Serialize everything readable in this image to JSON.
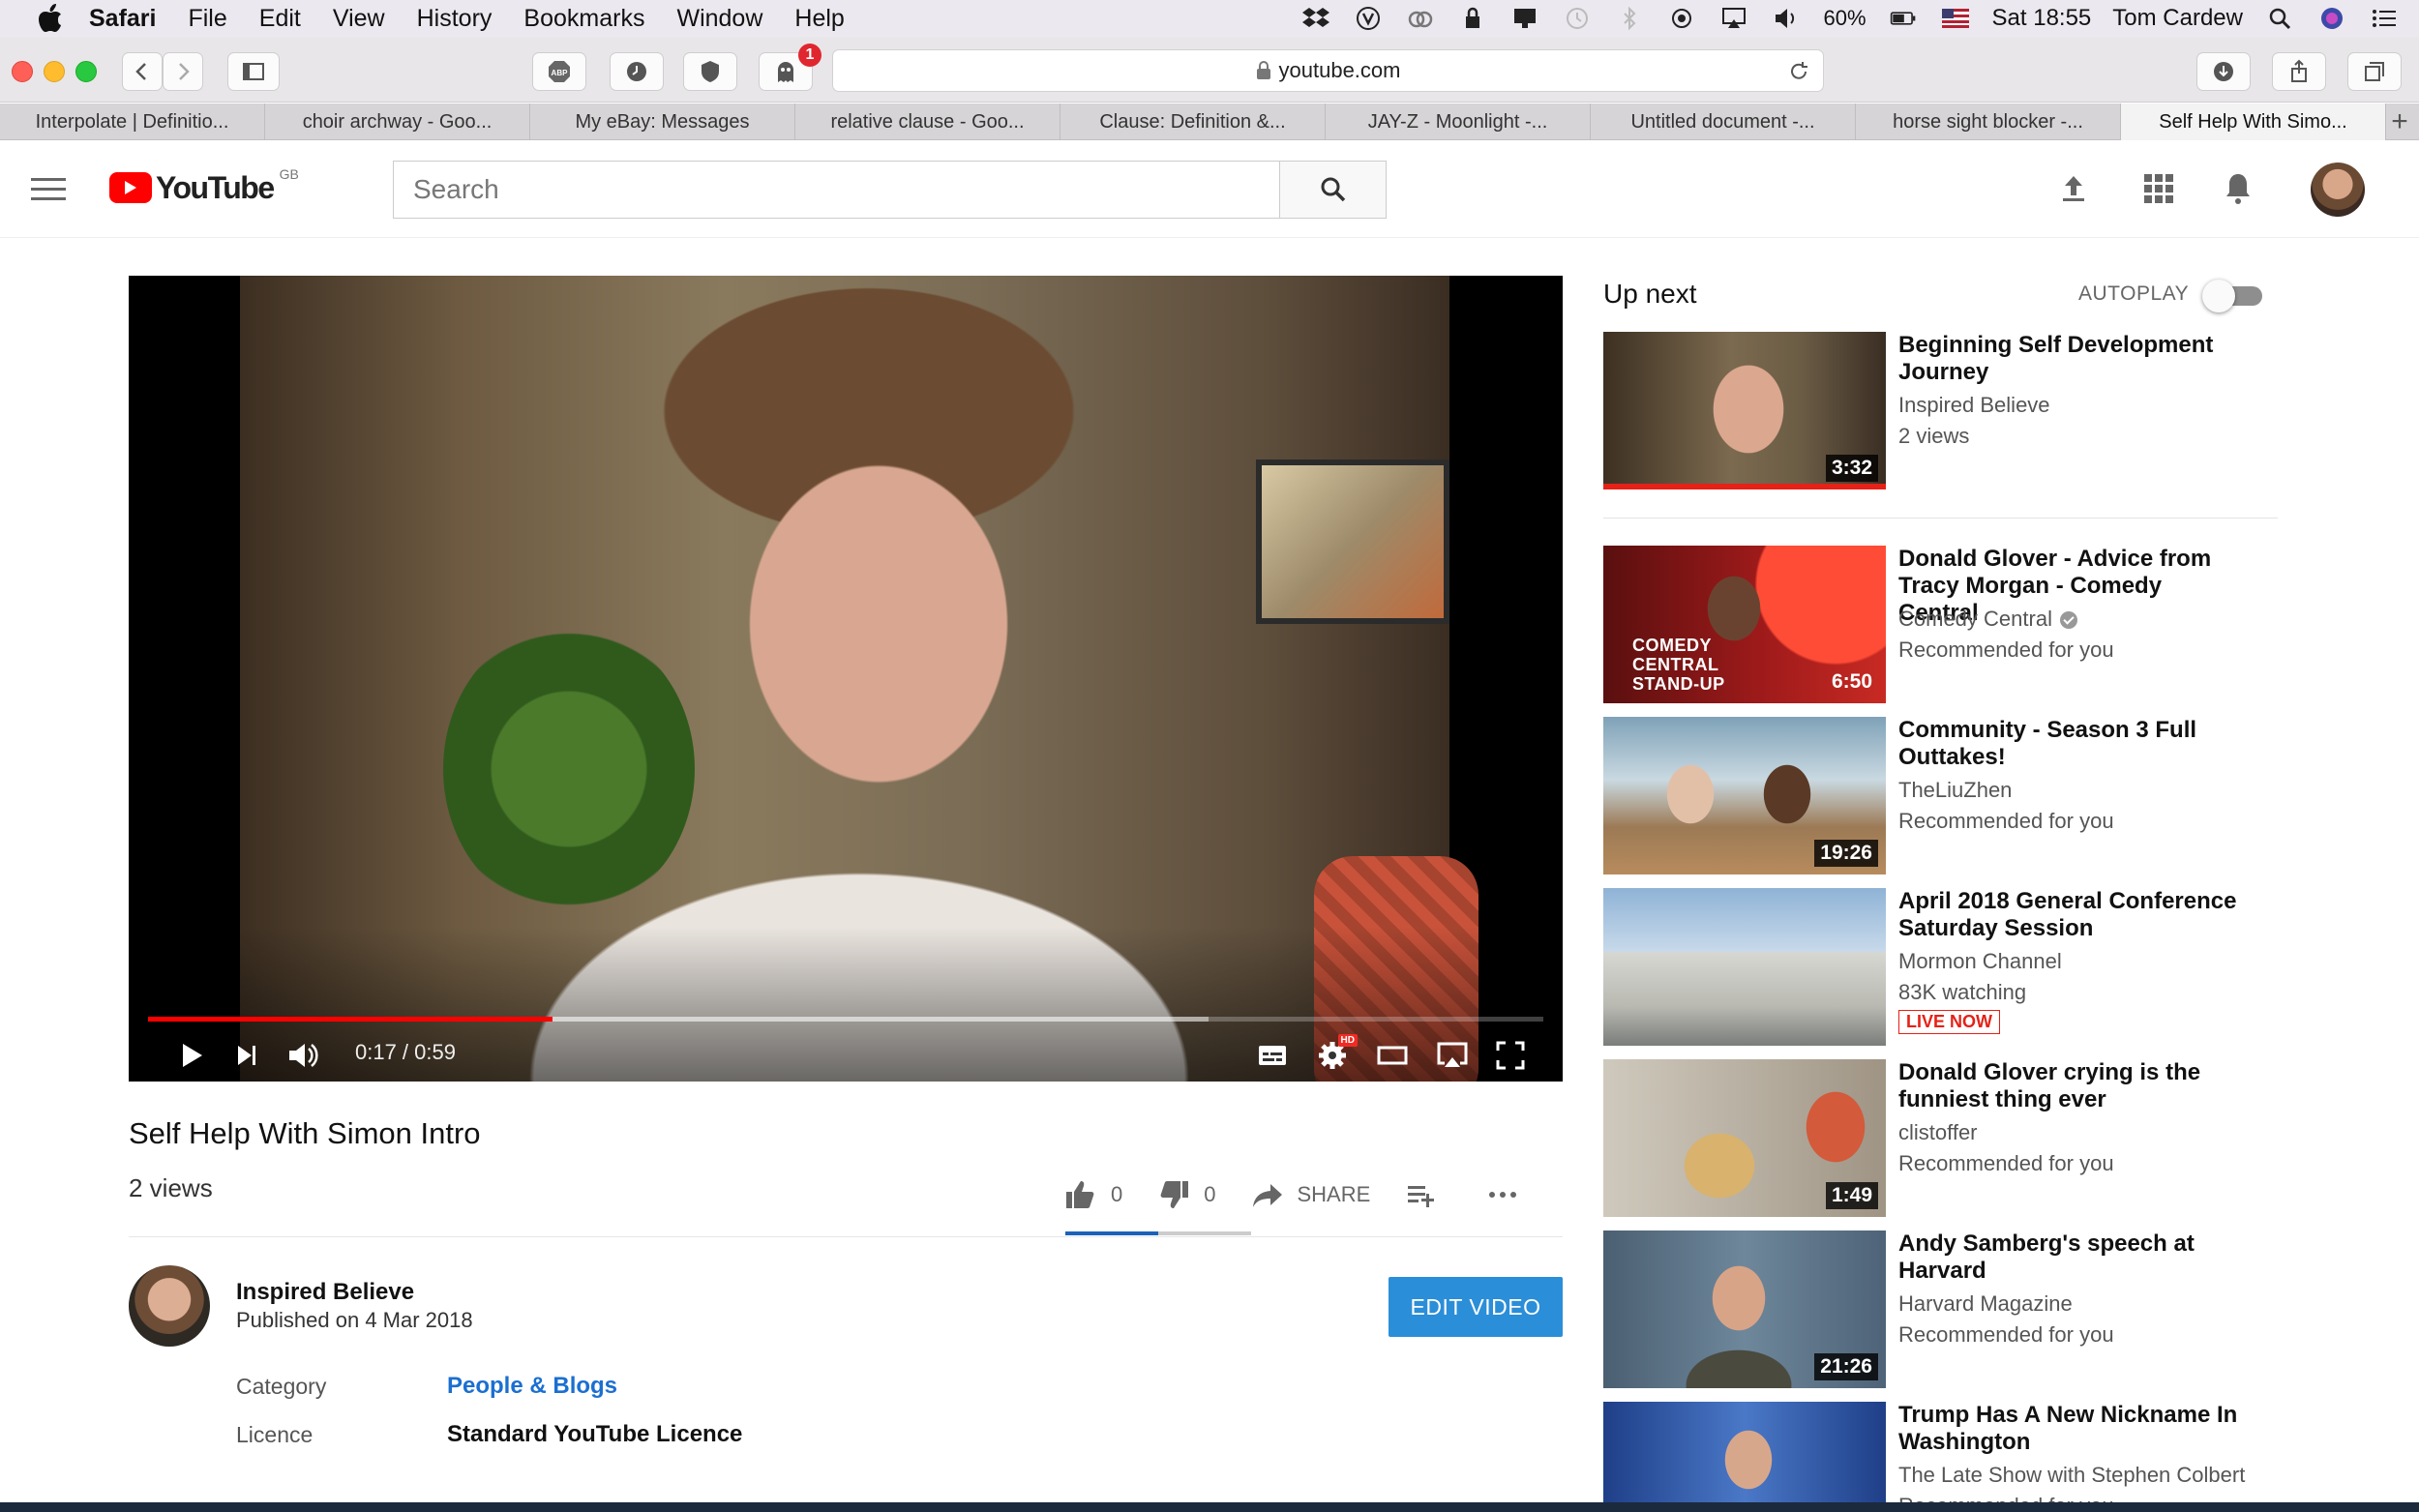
{
  "menubar": {
    "app": "Safari",
    "items": [
      "File",
      "Edit",
      "View",
      "History",
      "Bookmarks",
      "Window",
      "Help"
    ],
    "battery": "60%",
    "clock": "Sat 18:55",
    "user": "Tom Cardew"
  },
  "browser": {
    "url": "youtube.com",
    "adblock_badge": "1",
    "tabs": [
      "Interpolate | Definitio...",
      "choir archway - Goo...",
      "My eBay: Messages",
      "relative clause - Goo...",
      "Clause: Definition &...",
      "JAY-Z - Moonlight -...",
      "Untitled document -...",
      "horse sight blocker -...",
      "Self Help With Simo..."
    ],
    "active_tab": 8
  },
  "youtube": {
    "logo": "YouTube",
    "region": "GB",
    "search_placeholder": "Search"
  },
  "player": {
    "time": "0:17 / 0:59",
    "played_fraction": 0.29,
    "buffered_fraction": 0.76
  },
  "video": {
    "title": "Self Help With Simon Intro",
    "views": "2 views",
    "likes": "0",
    "dislikes": "0",
    "share_label": "SHARE",
    "channel": "Inspired Believe",
    "published": "Published on 4 Mar 2018",
    "edit_label": "EDIT VIDEO",
    "category_label": "Category",
    "category_value": "People & Blogs",
    "licence_label": "Licence",
    "licence_value": "Standard YouTube Licence"
  },
  "sidebar": {
    "up_next": "Up next",
    "autoplay": "AUTOPLAY",
    "autoplay_on": false,
    "items": [
      {
        "title": "Beginning Self Development Journey",
        "channel": "Inspired Believe",
        "meta": "2 views",
        "duration": "3:32"
      },
      {
        "title": "Donald Glover - Advice from Tracy Morgan - Comedy Central",
        "channel": "Comedy Central",
        "meta": "Recommended for you",
        "duration": "6:50",
        "brand": "COMEDY CENTRAL STAND-UP"
      },
      {
        "title": "Community - Season 3 Full Outtakes!",
        "channel": "TheLiuZhen",
        "meta": "Recommended for you",
        "duration": "19:26"
      },
      {
        "title": "April 2018 General Conference Saturday Session",
        "channel": "Mormon Channel",
        "meta": "83K watching",
        "badge": "LIVE NOW"
      },
      {
        "title": "Donald Glover crying is the funniest thing ever",
        "channel": "clistoffer",
        "meta": "Recommended for you",
        "duration": "1:49"
      },
      {
        "title": "Andy Samberg's speech at Harvard",
        "channel": "Harvard Magazine",
        "meta": "Recommended for you",
        "duration": "21:26"
      },
      {
        "title": "Trump Has A New Nickname In Washington",
        "channel": "The Late Show with Stephen Colbert",
        "meta": "Recommended for you"
      }
    ]
  }
}
